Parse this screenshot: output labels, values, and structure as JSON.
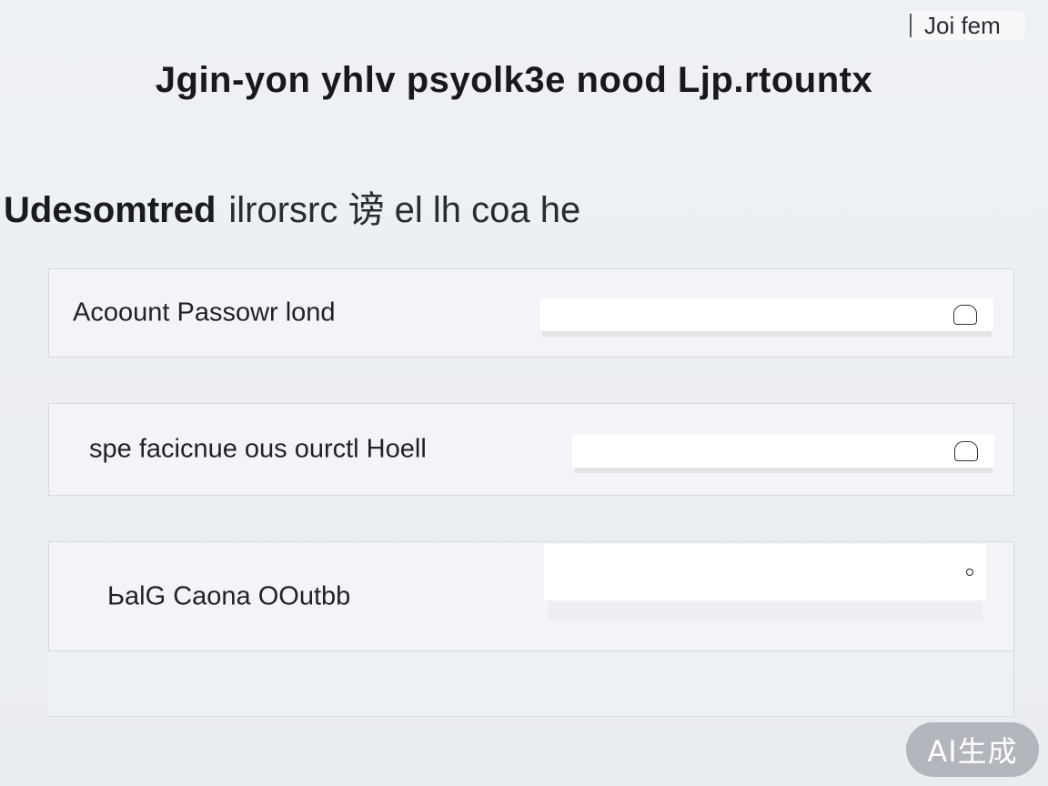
{
  "tab": {
    "label": "Joi fem"
  },
  "page_title": "Jgin-yon yhlv psyolk3e nood Ljp.rtountx",
  "section": {
    "strong": "Udesomtred",
    "light": "ilrorsrc 谤 el lh coa he"
  },
  "rows": [
    {
      "label": "Acoount Passowr lond",
      "icon": "lock-icon"
    },
    {
      "label": "spe facicnue ous ourctl Hoell",
      "icon": "lock-icon"
    },
    {
      "label": "ЬalG Caona OOutbb",
      "icon": "dot-icon"
    }
  ],
  "watermark": "AI生成"
}
